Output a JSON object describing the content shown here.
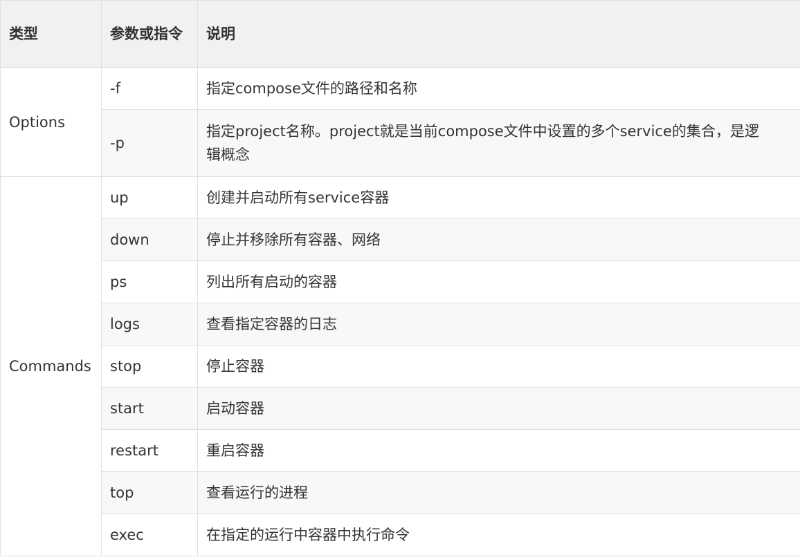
{
  "header": {
    "col_type": "类型",
    "col_param": "参数或指令",
    "col_desc": "说明"
  },
  "options": {
    "type_label": "Options",
    "rows": [
      {
        "param": "-f",
        "desc": "指定compose文件的路径和名称"
      },
      {
        "param": "-p",
        "desc": "指定project名称。project就是当前compose文件中设置的多个service的集合，是逻辑概念"
      }
    ]
  },
  "commands": {
    "type_label": "Commands",
    "rows": [
      {
        "param": "up",
        "desc": "创建并启动所有service容器"
      },
      {
        "param": "down",
        "desc": "停止并移除所有容器、网络"
      },
      {
        "param": "ps",
        "desc": "列出所有启动的容器"
      },
      {
        "param": "logs",
        "desc": "查看指定容器的日志"
      },
      {
        "param": "stop",
        "desc": "停止容器"
      },
      {
        "param": "start",
        "desc": "启动容器"
      },
      {
        "param": "restart",
        "desc": "重启容器"
      },
      {
        "param": "top",
        "desc": "查看运行的进程"
      },
      {
        "param": "exec",
        "desc": "在指定的运行中容器中执行命令"
      }
    ]
  }
}
